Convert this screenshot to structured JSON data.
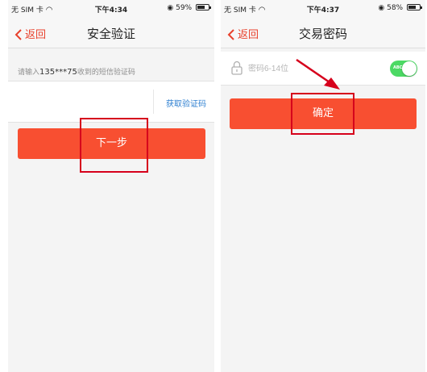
{
  "status_bar_left": {
    "carrier": "无 SIM 卡",
    "wifi_icon": "wifi-icon"
  },
  "screen1": {
    "status": {
      "time": "下午4:34",
      "battery": "59%",
      "battery_level": 0.59
    },
    "nav": {
      "back": "返回",
      "title": "安全验证"
    },
    "hint_prefix": "请输入",
    "hint_phone": "135***75",
    "hint_suffix": "收到的短信验证码",
    "get_code": "获取验证码",
    "next_button": "下一步"
  },
  "screen2": {
    "status": {
      "time": "下午4:37",
      "battery": "58%",
      "battery_level": 0.58
    },
    "nav": {
      "back": "返回",
      "title": "交易密码"
    },
    "password_placeholder": "密码6-14位",
    "toggle_label": "ABC",
    "confirm_button": "确定"
  },
  "colors": {
    "accent": "#f84f31",
    "link": "#2f80d1",
    "annotation": "#d6001c",
    "toggle_on": "#4cd964"
  }
}
